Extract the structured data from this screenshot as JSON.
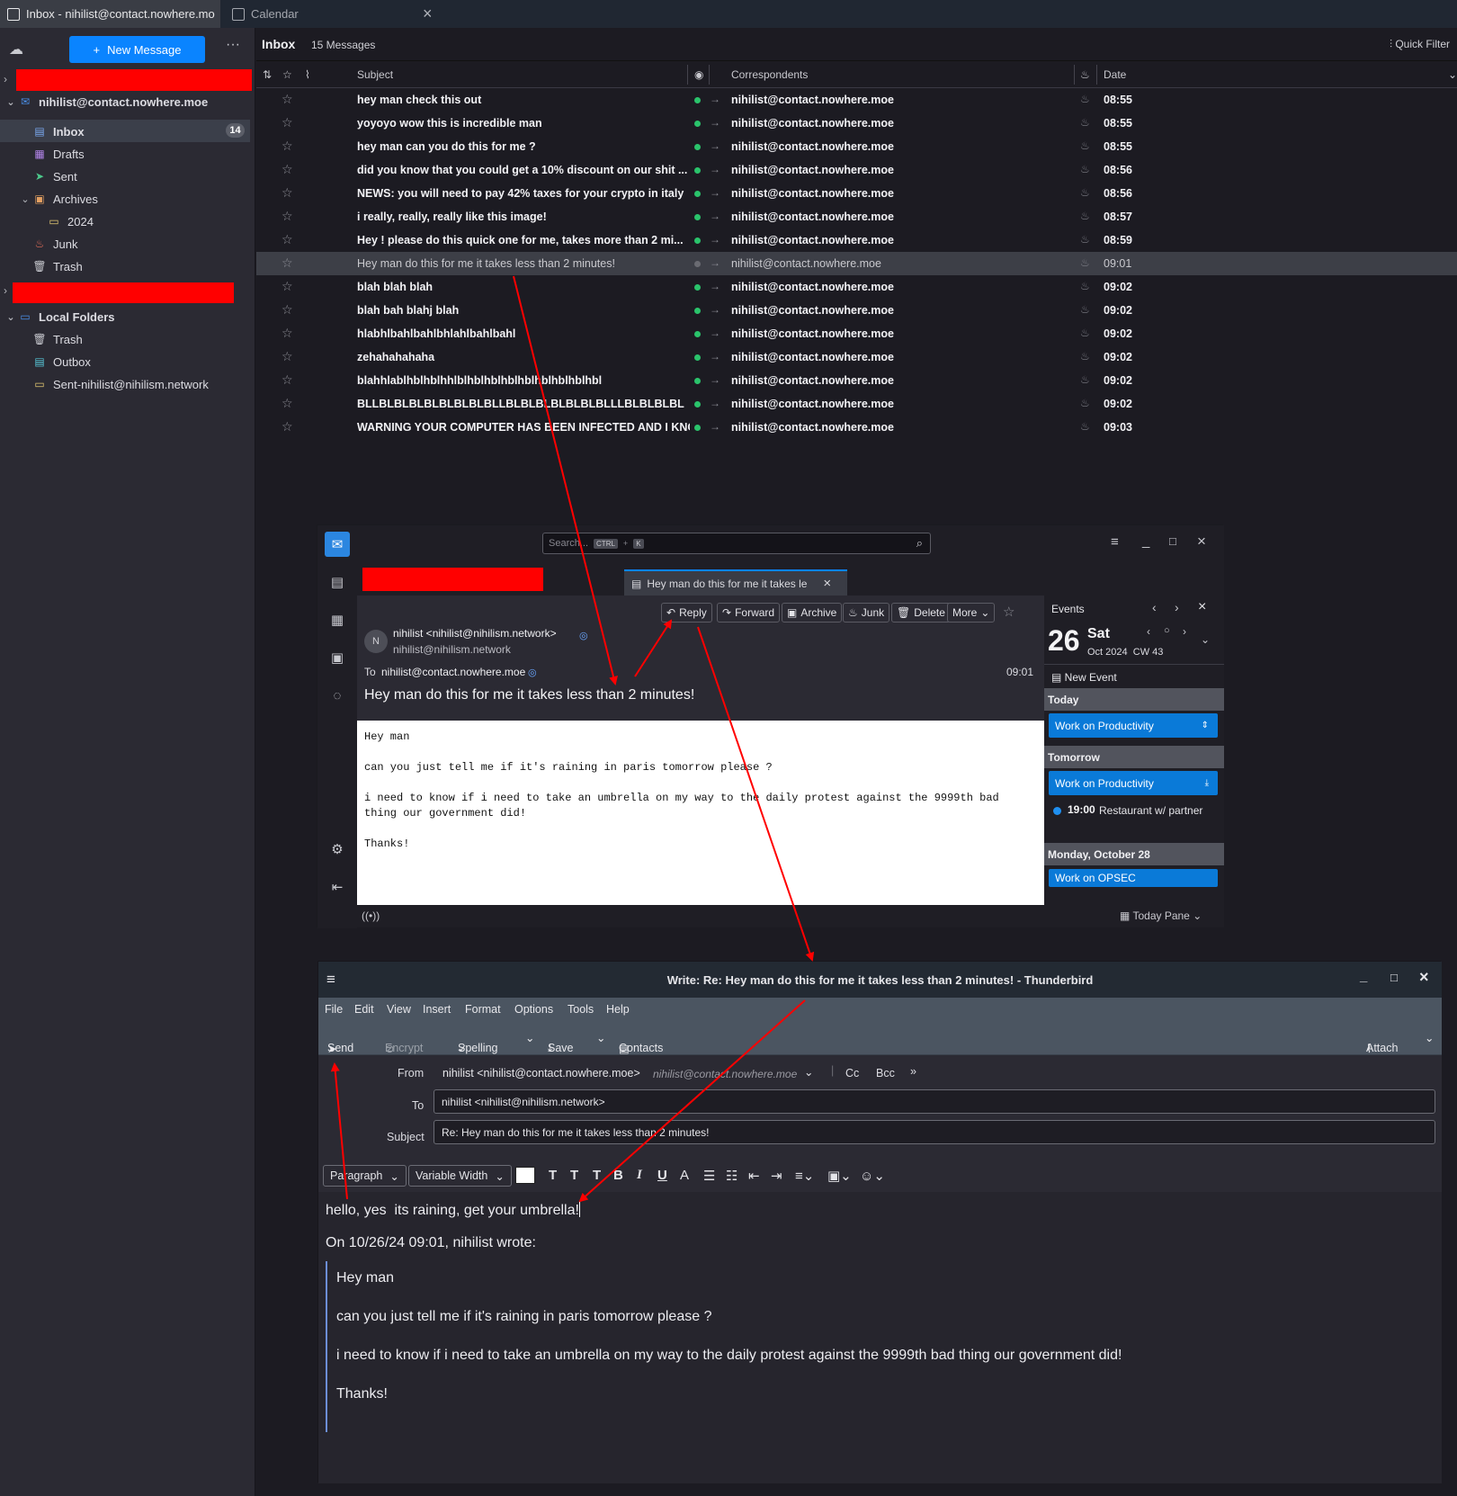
{
  "tabs": [
    {
      "label": "Inbox - nihilist@contact.nowhere.moe"
    },
    {
      "label": "Calendar"
    }
  ],
  "left": {
    "new_message": "New Message",
    "account": "nihilist@contact.nowhere.moe",
    "folders": [
      {
        "label": "Inbox",
        "badge": "14"
      },
      {
        "label": "Drafts"
      },
      {
        "label": "Sent"
      },
      {
        "label": "Archives"
      },
      {
        "label": "2024"
      },
      {
        "label": "Junk"
      },
      {
        "label": "Trash"
      }
    ],
    "local_folders": "Local Folders",
    "local": [
      {
        "label": "Trash"
      },
      {
        "label": "Outbox"
      },
      {
        "label": "Sent-nihilist@nihilism.network"
      }
    ]
  },
  "threadpane": {
    "title": "Inbox",
    "count": "15 Messages",
    "quick_filter": "Quick Filter",
    "columns": {
      "subject": "Subject",
      "correspondents": "Correspondents",
      "date": "Date"
    },
    "rows": [
      {
        "subject": "hey man check this out",
        "correspondent": "nihilist@contact.nowhere.moe",
        "date": "08:55",
        "read": false
      },
      {
        "subject": "yoyoyo wow this is incredible man",
        "correspondent": "nihilist@contact.nowhere.moe",
        "date": "08:55",
        "read": false
      },
      {
        "subject": "hey man can you do this for me ?",
        "correspondent": "nihilist@contact.nowhere.moe",
        "date": "08:55",
        "read": false
      },
      {
        "subject": "did you know that you could get a 10% discount on our shit ...",
        "correspondent": "nihilist@contact.nowhere.moe",
        "date": "08:56",
        "read": false
      },
      {
        "subject": "NEWS: you will need to pay 42% taxes for your crypto in italy",
        "correspondent": "nihilist@contact.nowhere.moe",
        "date": "08:56",
        "read": false
      },
      {
        "subject": "i really, really, really like this image!",
        "correspondent": "nihilist@contact.nowhere.moe",
        "date": "08:57",
        "read": false
      },
      {
        "subject": "Hey ! please do this quick one for me, takes more than 2 mi...",
        "correspondent": "nihilist@contact.nowhere.moe",
        "date": "08:59",
        "read": false
      },
      {
        "subject": "Hey man do this for me it takes less than 2 minutes!",
        "correspondent": "nihilist@contact.nowhere.moe",
        "date": "09:01",
        "read": true
      },
      {
        "subject": "blah blah blah",
        "correspondent": "nihilist@contact.nowhere.moe",
        "date": "09:02",
        "read": false
      },
      {
        "subject": "blah bah blahj blah",
        "correspondent": "nihilist@contact.nowhere.moe",
        "date": "09:02",
        "read": false
      },
      {
        "subject": "hlabhlbahlbahlbhlahlbahlbahl",
        "correspondent": "nihilist@contact.nowhere.moe",
        "date": "09:02",
        "read": false
      },
      {
        "subject": "zehahahahaha",
        "correspondent": "nihilist@contact.nowhere.moe",
        "date": "09:02",
        "read": false
      },
      {
        "subject": "blahhlablhblhblhhlblhblhblhblhblhblhblhblhbl",
        "correspondent": "nihilist@contact.nowhere.moe",
        "date": "09:02",
        "read": false
      },
      {
        "subject": "BLLBLBLBLBLBLBLBLBLLBLBLBLBLBLBLBLLLBLBLBLBL",
        "correspondent": "nihilist@contact.nowhere.moe",
        "date": "09:02",
        "read": false
      },
      {
        "subject": "WARNING YOUR COMPUTER HAS BEEN INFECTED AND I KNO...",
        "correspondent": "nihilist@contact.nowhere.moe",
        "date": "09:03",
        "read": false
      }
    ]
  },
  "message": {
    "search_placeholder": "Search...",
    "kbd1": "CTRL",
    "kbd2": "K",
    "tab_title": "Hey man do this for me it takes le",
    "buttons": {
      "reply": "Reply",
      "forward": "Forward",
      "archive": "Archive",
      "junk": "Junk",
      "delete": "Delete",
      "more": "More"
    },
    "from_name": "nihilist <nihilist@nihilism.network>",
    "from_email": "nihilist@nihilism.network",
    "avatar": "N",
    "to_label": "To",
    "to": "nihilist@contact.nowhere.moe",
    "time": "09:01",
    "subject": "Hey man do this for me it takes less than 2 minutes!",
    "body": "Hey man\n\ncan you just tell me if it's raining in paris tomorrow please ?\n\ni need to know if i need to take an umbrella on my way to the daily protest against the 9999th bad\nthing our government did!\n\nThanks!",
    "today_pane": "Today Pane"
  },
  "events": {
    "title": "Events",
    "day_num": "26",
    "day_name": "Sat",
    "month_line": "Oct 2024  CW 43",
    "new_event": "New Event",
    "today": "Today",
    "today_event": "Work on Productivity",
    "tomorrow": "Tomorrow",
    "tomorrow_event": "Work on Productivity",
    "time_event_time": "19:00",
    "time_event_title": "Restaurant w/ partner",
    "monday": "Monday, October 28",
    "monday_event": "Work on OPSEC"
  },
  "compose": {
    "title": "Write: Re: Hey man do this for me it takes less than 2 minutes! - Thunderbird",
    "menu": [
      "File",
      "Edit",
      "View",
      "Insert",
      "Format",
      "Options",
      "Tools",
      "Help"
    ],
    "tools": {
      "send": "Send",
      "encrypt": "Encrypt",
      "spelling": "Spelling",
      "save": "Save",
      "contacts": "Contacts",
      "attach": "Attach"
    },
    "from_label": "From",
    "from_value": "nihilist <nihilist@contact.nowhere.moe>",
    "from_hint": "nihilist@contact.nowhere.moe",
    "cc": "Cc",
    "bcc": "Bcc",
    "to_label": "To",
    "to_value": "nihilist <nihilist@nihilism.network>",
    "subject_label": "Subject",
    "subject_value": "Re: Hey man do this for me it takes less than 2 minutes!",
    "paragraph": "Paragraph",
    "font": "Variable Width",
    "reply_text": "hello, yes  its raining, get your umbrella!",
    "wrote": "On 10/26/24 09:01, nihilist wrote:",
    "quote": [
      "Hey man",
      "can you just tell me if it's raining in paris tomorrow please ?",
      "i need to know if i need to take an umbrella on my way to the daily protest against the 9999th bad thing our government did!",
      "Thanks!"
    ]
  },
  "colors": {
    "accent": "#0a84ff",
    "annotation": "#ff0000",
    "unread_dot": "#2ac36b"
  }
}
